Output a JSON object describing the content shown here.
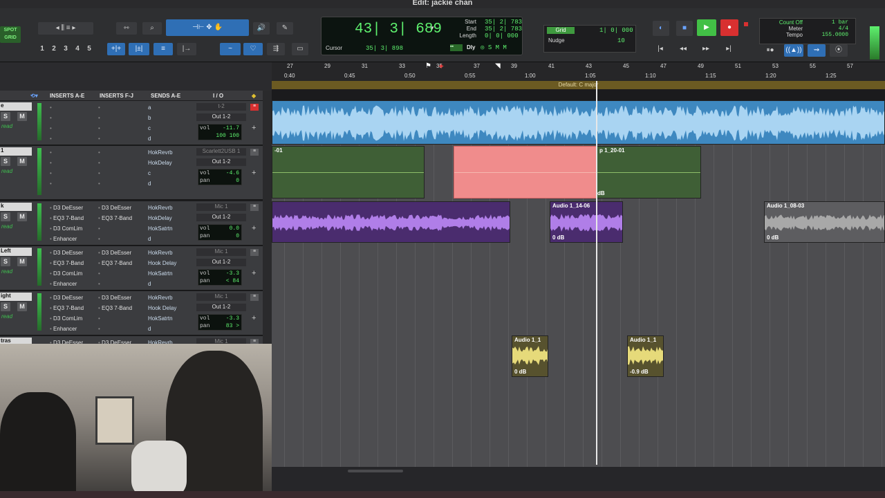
{
  "window": {
    "title": "Edit: jackie chan"
  },
  "toolbar": {
    "mode_labels": [
      "SPOT",
      "GRID"
    ],
    "zoom_presets": [
      "1",
      "2",
      "3",
      "4",
      "5"
    ],
    "counter": {
      "main": "43| 3| 689",
      "start_label": "Start",
      "start": "35| 2| 783",
      "end_label": "End",
      "end": "35| 2| 783",
      "length_label": "Length",
      "length": "0| 0| 000",
      "cursor_label": "Cursor",
      "cursor": "35| 3| 898",
      "dly_label": "Dly"
    },
    "grid": {
      "label": "Grid",
      "value": "1| 0| 000"
    },
    "nudge": {
      "label": "Nudge",
      "value": "10"
    },
    "count": {
      "count_off": "Count Off",
      "meter_label": "Meter",
      "tempo_label": "Tempo",
      "bar": "1 bar",
      "meter": "4/4",
      "tempo": "155.0000"
    }
  },
  "ruler": {
    "bars": [
      "27",
      "29",
      "31",
      "33",
      "35",
      "37",
      "39",
      "41",
      "43",
      "45",
      "47",
      "49",
      "51",
      "53",
      "55",
      "57"
    ],
    "times": [
      "0:40",
      "0:45",
      "0:50",
      "0:55",
      "1:00",
      "1:05",
      "1:10",
      "1:15",
      "1:20",
      "1:25"
    ],
    "key_signature": "Default: C major"
  },
  "mix_header": {
    "inserts_ae": "INSERTS A-E",
    "inserts_fj": "INSERTS F-J",
    "sends_ae": "SENDS A-E",
    "io": "I / O"
  },
  "tracks": [
    {
      "name": "e",
      "auto": "read",
      "inserts": [
        "",
        "",
        "",
        "",
        ""
      ],
      "inserts2": [
        "",
        "",
        "",
        "",
        ""
      ],
      "sends": [
        "a",
        "b",
        "c",
        "d",
        ""
      ],
      "input": "t-2",
      "output": "Out 1-2",
      "vol": "-11.7",
      "pan": "100 100",
      "pan_label": ""
    },
    {
      "name": "1",
      "auto": "read",
      "sub": "rm",
      "inserts": [
        "",
        "",
        "",
        "",
        ""
      ],
      "inserts2": [
        "",
        "",
        "",
        "",
        ""
      ],
      "sends": [
        "HokRevrb",
        "HokDelay",
        "c",
        "d",
        "e"
      ],
      "input": "Scarlett2USB 1",
      "output": "Out 1-2",
      "vol": "-4.6",
      "pan": "0",
      "pan_label": "pan"
    },
    {
      "name": "k",
      "auto": "read",
      "inserts": [
        "D3 DeEsser",
        "EQ3 7-Band",
        "D3 ComLim",
        "Enhancer"
      ],
      "inserts2": [
        "D3 DeEsser",
        "EQ3 7-Band",
        "",
        ""
      ],
      "sends": [
        "HokRevrb",
        "HokDelay",
        "HokSatrtn",
        "d"
      ],
      "input": "Mic 1",
      "output": "Out 1-2",
      "vol": "0.0",
      "pan": "0",
      "pan_label": "pan"
    },
    {
      "name": "Left",
      "auto": "read",
      "inserts": [
        "D3 DeEsser",
        "EQ3 7-Band",
        "D3 ComLim",
        "Enhancer"
      ],
      "inserts2": [
        "D3 DeEsser",
        "EQ3 7-Band",
        "",
        ""
      ],
      "sends": [
        "HokRevrb",
        "Hook Delay",
        "HokSatrtn",
        "d"
      ],
      "input": "Mic 1",
      "output": "Out 1-2",
      "vol": "-3.3",
      "pan": "< 84",
      "pan_label": "pan"
    },
    {
      "name": "ight",
      "auto": "read",
      "inserts": [
        "D3 DeEsser",
        "EQ3 7-Band",
        "D3 ComLim",
        "Enhancer"
      ],
      "inserts2": [
        "D3 DeEsser",
        "EQ3 7-Band",
        "",
        ""
      ],
      "sends": [
        "HokRevrb",
        "Hook Delay",
        "HokSatrtn",
        "d"
      ],
      "input": "Mic 1",
      "output": "Out 1-2",
      "vol": "-3.3",
      "pan": "83 >",
      "pan_label": "pan"
    },
    {
      "name": "tras",
      "auto": "",
      "inserts": [
        "D3 DeEsser"
      ],
      "inserts2": [
        "D3 DeEsser"
      ],
      "sends": [
        "HokRevrb"
      ],
      "input": "Mic 1",
      "output": "",
      "vol": "",
      "pan": "",
      "pan_label": ""
    }
  ],
  "clips": {
    "track2_left": "-01",
    "track2_right": "p 1_20-01",
    "track2_right_db": "dB",
    "track3_mid": "Audio 1_14-06",
    "track3_mid_db": "0 dB",
    "track3_right": "Audio 1_08-03",
    "track3_right_db": "0 dB",
    "track6_a": "Audio 1_1",
    "track6_a_db": "0 dB",
    "track6_b": "Audio 1_1",
    "track6_b_db": "-0.9 dB"
  },
  "colors": {
    "accent": "#2f6fb5",
    "counter_green": "#5ef06e",
    "record_red": "#d83030",
    "clip_blue": "#3e88c0",
    "clip_green": "#3f5f36",
    "clip_pink": "#f08c8c",
    "clip_purple": "#4a2c6e",
    "clip_gray": "#5d5d60",
    "clip_yellow": "#57522e"
  }
}
